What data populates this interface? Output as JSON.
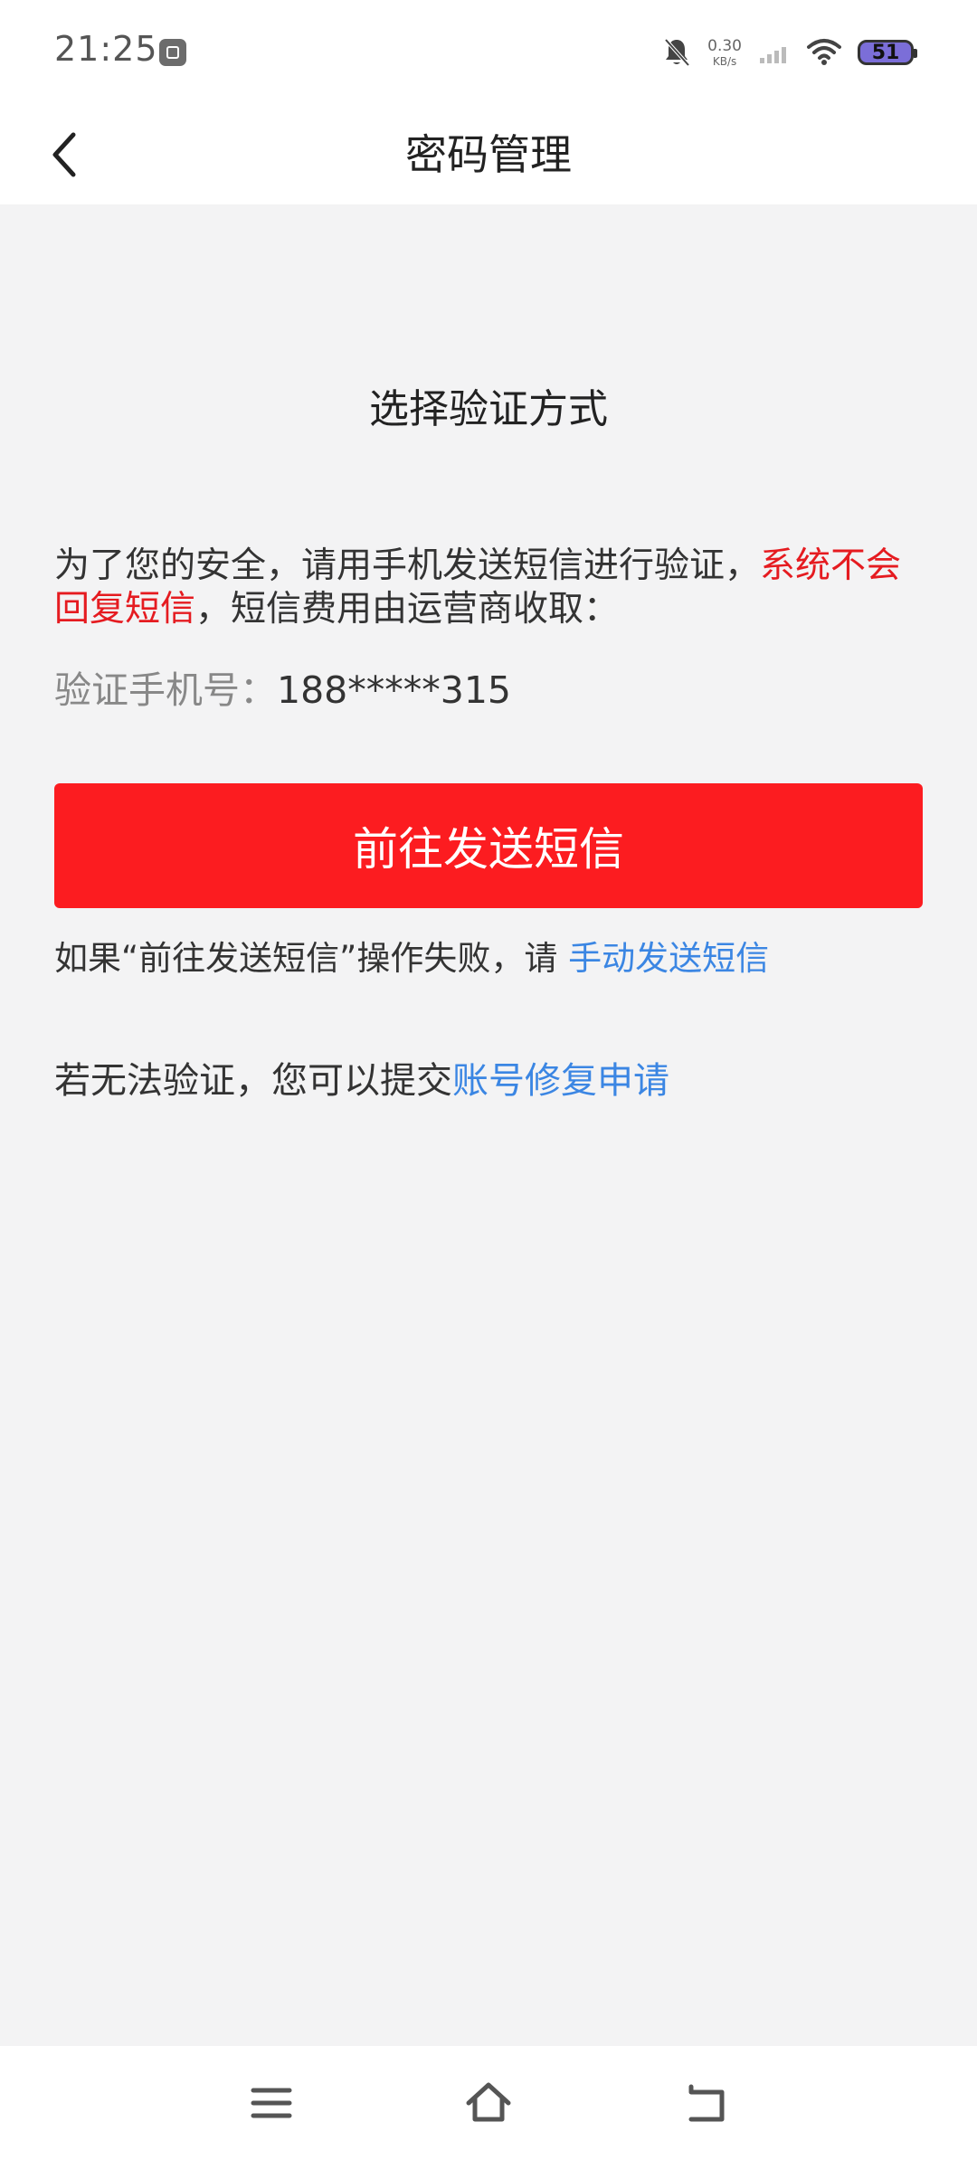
{
  "status_bar": {
    "time": "21:25",
    "net_speed_value": "0.30",
    "net_speed_unit": "KB/s",
    "battery_level": "51",
    "battery_color": "#7b6ed8"
  },
  "header": {
    "title": "密码管理"
  },
  "main": {
    "section_title": "选择验证方式",
    "desc_part1": "为了您的安全，请用手机发送短信进行验证，",
    "desc_red": "系统不会回复短信",
    "desc_part2": "，短信费用由运营商收取：",
    "phone_label": "验证手机号：",
    "phone_value": "188*****315",
    "send_button": "前往发送短信",
    "fail_text": "如果“前往发送短信”操作失败，请 ",
    "fail_link": "手动发送短信",
    "repair_text": "若无法验证，您可以提交",
    "repair_link": "账号修复申请"
  },
  "colors": {
    "primary_red": "#fc1c20",
    "link_blue": "#3b86e3",
    "warning_red": "#e51b20",
    "background": "#f3f3f4"
  },
  "icons": {
    "back": "chevron-left-icon",
    "bell_off": "bell-off-icon",
    "signal": "signal-icon",
    "wifi": "wifi-icon",
    "menu": "menu-icon",
    "home": "home-icon",
    "return": "return-icon"
  }
}
